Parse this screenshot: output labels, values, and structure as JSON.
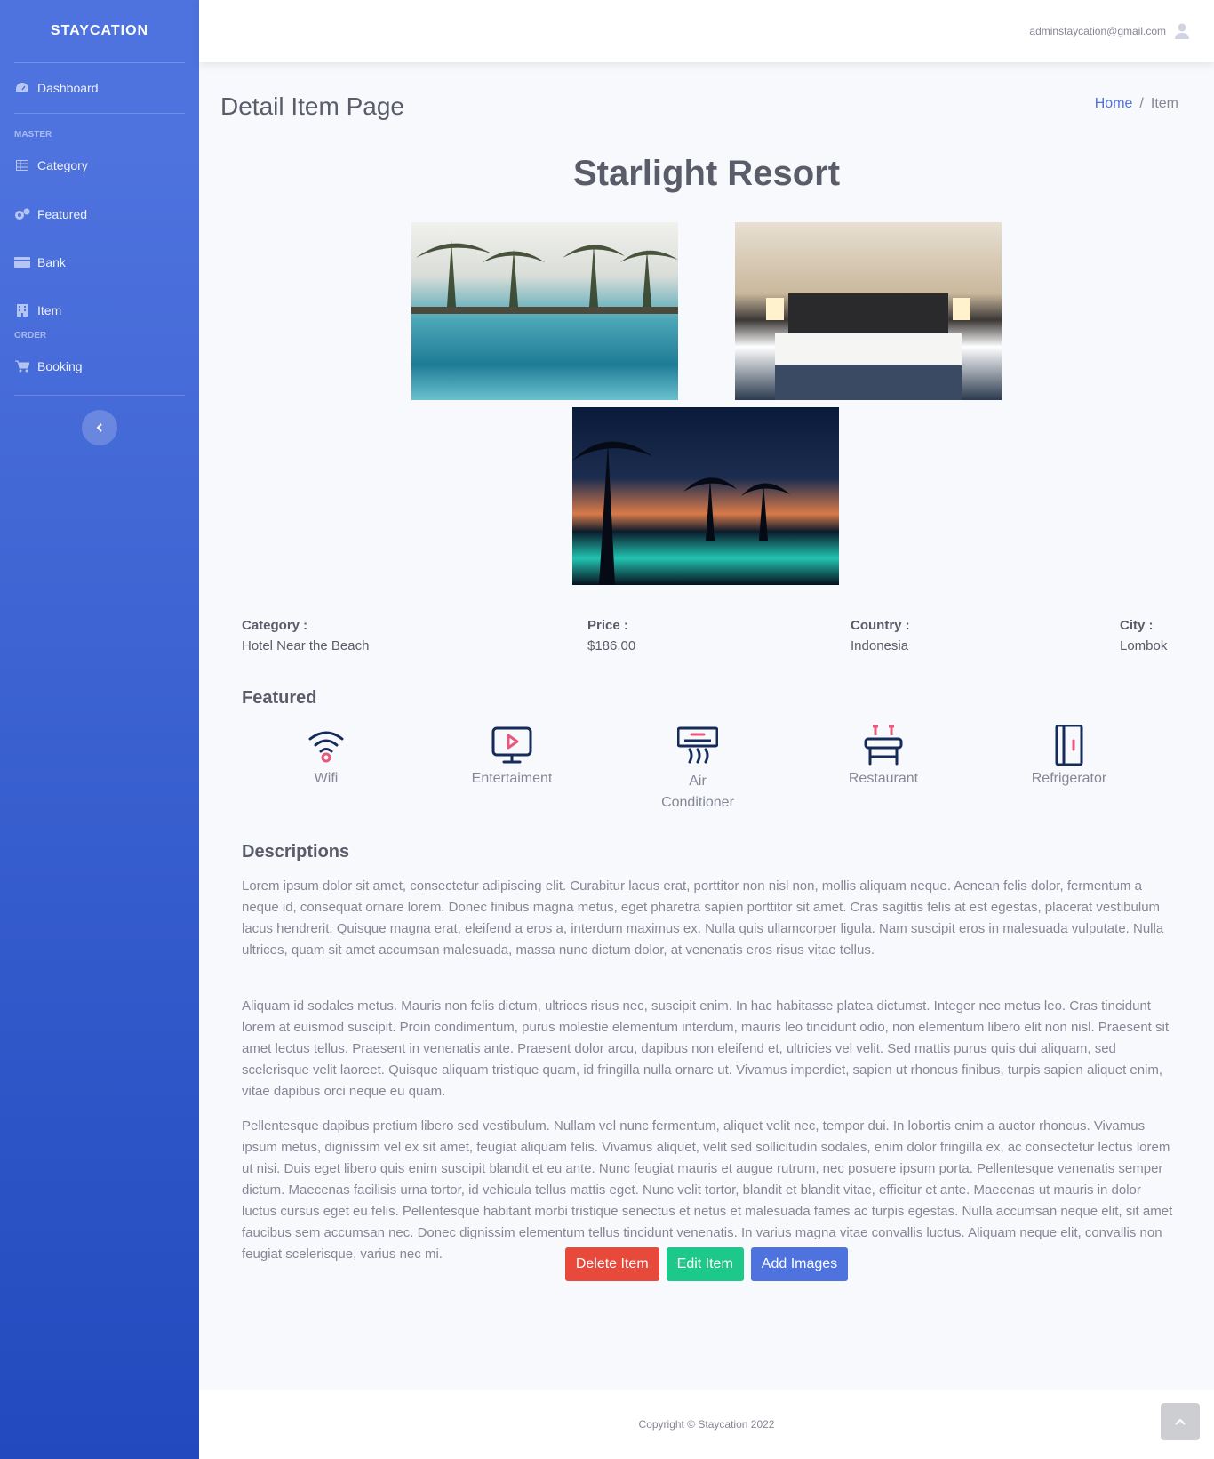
{
  "sidebar": {
    "brand": "STAYCATION",
    "dashboard": "Dashboard",
    "heading_master": "MASTER",
    "category": "Category",
    "featured": "Featured",
    "bank": "Bank",
    "item": "Item",
    "heading_order": "ORDER",
    "booking": "Booking"
  },
  "topbar": {
    "user_email": "adminstaycation@gmail.com"
  },
  "page": {
    "title": "Detail Item Page",
    "breadcrumb": {
      "home": "Home",
      "separator": "/",
      "current": "Item"
    }
  },
  "item": {
    "name": "Starlight Resort",
    "info": {
      "category_label": "Category :",
      "category_value": "Hotel Near the Beach",
      "price_label": "Price :",
      "price_value": "$186.00",
      "country_label": "Country :",
      "country_value": "Indonesia",
      "city_label": "City :",
      "city_value": "Lombok"
    },
    "featured_title": "Featured",
    "features": [
      "Wifi",
      "Entertaiment",
      "Air Conditioner",
      "Restaurant",
      "Refrigerator"
    ],
    "descriptions_title": "Descriptions",
    "descriptions": [
      "Lorem ipsum dolor sit amet, consectetur adipiscing elit. Curabitur lacus erat, porttitor non nisl non, mollis aliquam neque. Aenean felis dolor, fermentum a neque id, consequat ornare lorem. Donec finibus magna metus, eget pharetra sapien porttitor sit amet. Cras sagittis felis at est egestas, placerat vestibulum lacus hendrerit. Quisque magna erat, eleifend a eros a, interdum maximus ex. Nulla quis ullamcorper ligula. Nam suscipit eros in malesuada vulputate. Nulla ultrices, quam sit amet accumsan malesuada, massa nunc dictum dolor, at venenatis eros risus vitae tellus.",
      "Aliquam id sodales metus. Mauris non felis dictum, ultrices risus nec, suscipit enim. In hac habitasse platea dictumst. Integer nec metus leo. Cras tincidunt lorem at euismod suscipit. Proin condimentum, purus molestie elementum interdum, mauris leo tincidunt odio, non elementum libero elit non nisl. Praesent sit amet lectus tellus. Praesent in venenatis ante. Praesent dolor arcu, dapibus non eleifend et, ultricies vel velit. Sed mattis purus quis dui aliquam, sed scelerisque velit laoreet. Quisque aliquam tristique quam, id fringilla nulla ornare ut. Vivamus imperdiet, sapien ut rhoncus finibus, turpis sapien aliquet enim, vitae dapibus orci neque eu quam.",
      "Pellentesque dapibus pretium libero sed vestibulum. Nullam vel nunc fermentum, aliquet velit nec, tempor dui. In lobortis enim a auctor rhoncus. Vivamus ipsum metus, dignissim vel ex sit amet, feugiat aliquam felis. Vivamus aliquet, velit sed sollicitudin sodales, enim dolor fringilla ex, ac consectetur lectus lorem ut nisi. Duis eget libero quis enim suscipit blandit et eu ante. Nunc feugiat mauris et augue rutrum, nec posuere ipsum porta. Pellentesque venenatis semper dictum. Maecenas facilisis urna tortor, id vehicula tellus mattis eget. Nunc velit tortor, blandit et blandit vitae, efficitur et ante. Maecenas ut mauris in dolor luctus cursus eget eu felis. Pellentesque habitant morbi tristique senectus et netus et malesuada fames ac turpis egestas. Nulla accumsan neque elit, sit amet faucibus sem accumsan nec. Donec dignissim elementum tellus tincidunt venenatis. In varius magna vitae convallis luctus. Aliquam neque elit, convallis non feugiat scelerisque, varius nec mi."
    ]
  },
  "actions": {
    "delete": "Delete Item",
    "edit": "Edit Item",
    "add_images": "Add Images"
  },
  "footer": {
    "copyright": "Copyright © Staycation 2022"
  },
  "colors": {
    "primary": "#4e73df",
    "danger": "#e74a3b",
    "success": "#1cc88a",
    "accent_pink": "#e8577c",
    "icon_navy": "#152c5b"
  }
}
